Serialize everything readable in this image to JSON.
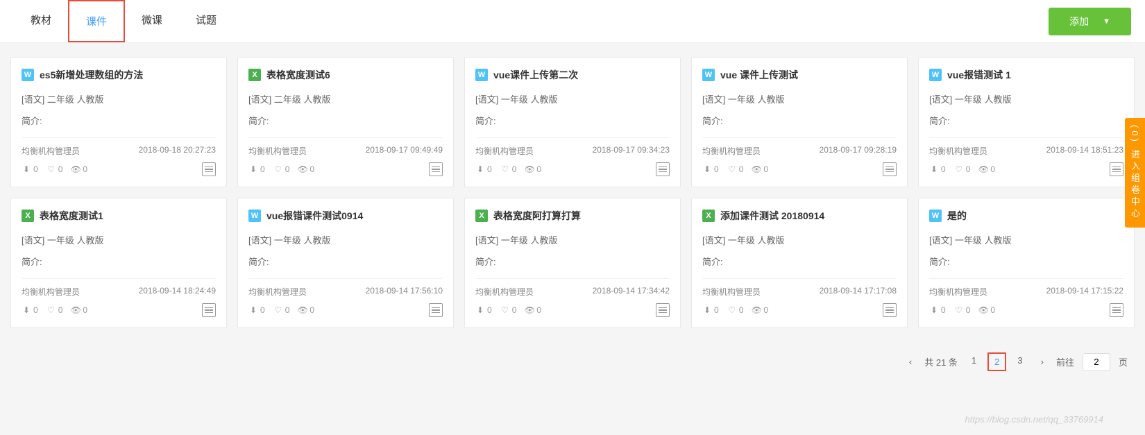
{
  "tabs": {
    "items": [
      "教材",
      "课件",
      "微课",
      "试题"
    ],
    "active_index": 1
  },
  "add_button": "添加",
  "side_tab": "(0) 进入组卷中心",
  "intro_label": "简介:",
  "cards": [
    {
      "icon_type": "w",
      "icon_text": "W",
      "title": "es5新增处理数组的方法",
      "meta": "[语文] 二年级 人教版",
      "author": "均衡机构管理员",
      "date": "2018-09-18 20:27:23",
      "downloads": "0",
      "likes": "0",
      "views": "0"
    },
    {
      "icon_type": "x",
      "icon_text": "X",
      "title": "表格宽度测试6",
      "meta": "[语文] 二年级 人教版",
      "author": "均衡机构管理员",
      "date": "2018-09-17 09:49:49",
      "downloads": "0",
      "likes": "0",
      "views": "0"
    },
    {
      "icon_type": "w",
      "icon_text": "W",
      "title": "vue课件上传第二次",
      "meta": "[语文] 一年级 人教版",
      "author": "均衡机构管理员",
      "date": "2018-09-17 09:34:23",
      "downloads": "0",
      "likes": "0",
      "views": "0"
    },
    {
      "icon_type": "w",
      "icon_text": "W",
      "title": "vue 课件上传测试",
      "meta": "[语文] 一年级 人教版",
      "author": "均衡机构管理员",
      "date": "2018-09-17 09:28:19",
      "downloads": "0",
      "likes": "0",
      "views": "0"
    },
    {
      "icon_type": "w",
      "icon_text": "W",
      "title": "vue报错测试 1",
      "meta": "[语文] 一年级 人教版",
      "author": "均衡机构管理员",
      "date": "2018-09-14 18:51:23",
      "downloads": "0",
      "likes": "0",
      "views": "0"
    },
    {
      "icon_type": "x",
      "icon_text": "X",
      "title": "表格宽度测试1",
      "meta": "[语文] 一年级 人教版",
      "author": "均衡机构管理员",
      "date": "2018-09-14 18:24:49",
      "downloads": "0",
      "likes": "0",
      "views": "0"
    },
    {
      "icon_type": "w",
      "icon_text": "W",
      "title": "vue报错课件测试0914",
      "meta": "[语文] 一年级 人教版",
      "author": "均衡机构管理员",
      "date": "2018-09-14 17:56:10",
      "downloads": "0",
      "likes": "0",
      "views": "0"
    },
    {
      "icon_type": "x",
      "icon_text": "X",
      "title": "表格宽度阿打算打算",
      "meta": "[语文] 一年级 人教版",
      "author": "均衡机构管理员",
      "date": "2018-09-14 17:34:42",
      "downloads": "0",
      "likes": "0",
      "views": "0"
    },
    {
      "icon_type": "x",
      "icon_text": "X",
      "title": "添加课件测试 20180914",
      "meta": "[语文] 一年级 人教版",
      "author": "均衡机构管理员",
      "date": "2018-09-14 17:17:08",
      "downloads": "0",
      "likes": "0",
      "views": "0"
    },
    {
      "icon_type": "w",
      "icon_text": "W",
      "title": "是的",
      "meta": "[语文] 一年级 人教版",
      "author": "均衡机构管理员",
      "date": "2018-09-14 17:15:22",
      "downloads": "0",
      "likes": "0",
      "views": "0"
    }
  ],
  "pagination": {
    "total_label": "共 21 条",
    "pages": [
      "1",
      "2",
      "3"
    ],
    "current": 1,
    "goto_label": "前往",
    "goto_value": "2",
    "page_suffix": "页"
  },
  "watermark": "https://blog.csdn.net/qq_33769914"
}
